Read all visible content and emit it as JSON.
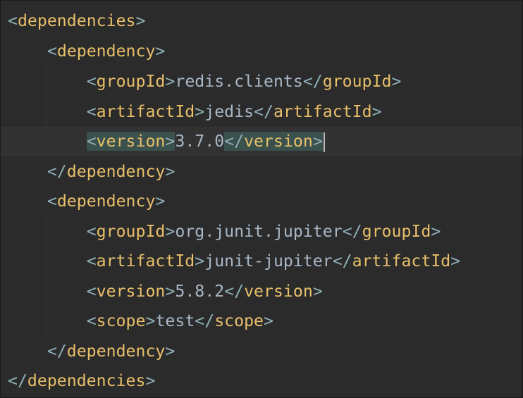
{
  "code": {
    "lines": [
      {
        "indent": "",
        "tag_open": "dependencies",
        "text": "",
        "tag_close": ""
      },
      {
        "indent": "    ",
        "tag_open": "dependency",
        "text": "",
        "tag_close": ""
      },
      {
        "indent": "        ",
        "tag_open": "groupId",
        "text": "redis.clients",
        "tag_close": "groupId"
      },
      {
        "indent": "        ",
        "tag_open": "artifactId",
        "text": "jedis",
        "tag_close": "artifactId"
      },
      {
        "indent": "        ",
        "tag_open": "version",
        "text": "3.7.0",
        "tag_close": "version"
      },
      {
        "indent": "    ",
        "tag_open": "",
        "text": "",
        "tag_close": "dependency"
      },
      {
        "indent": "    ",
        "tag_open": "dependency",
        "text": "",
        "tag_close": ""
      },
      {
        "indent": "        ",
        "tag_open": "groupId",
        "text": "org.junit.jupiter",
        "tag_close": "groupId"
      },
      {
        "indent": "        ",
        "tag_open": "artifactId",
        "text": "junit-jupiter",
        "tag_close": "artifactId"
      },
      {
        "indent": "        ",
        "tag_open": "version",
        "text": "5.8.2",
        "tag_close": "version"
      },
      {
        "indent": "        ",
        "tag_open": "scope",
        "text": "test",
        "tag_close": "scope"
      },
      {
        "indent": "    ",
        "tag_open": "",
        "text": "",
        "tag_close": "dependency"
      },
      {
        "indent": "",
        "tag_open": "",
        "text": "",
        "tag_close": "dependencies"
      }
    ]
  },
  "colors": {
    "background": "#2b2b2b",
    "bracket": "#8fb0b8",
    "tag": "#e8bf6a",
    "text": "#a9b7c6",
    "current_line": "#323232",
    "match_highlight": "#3b514d"
  }
}
